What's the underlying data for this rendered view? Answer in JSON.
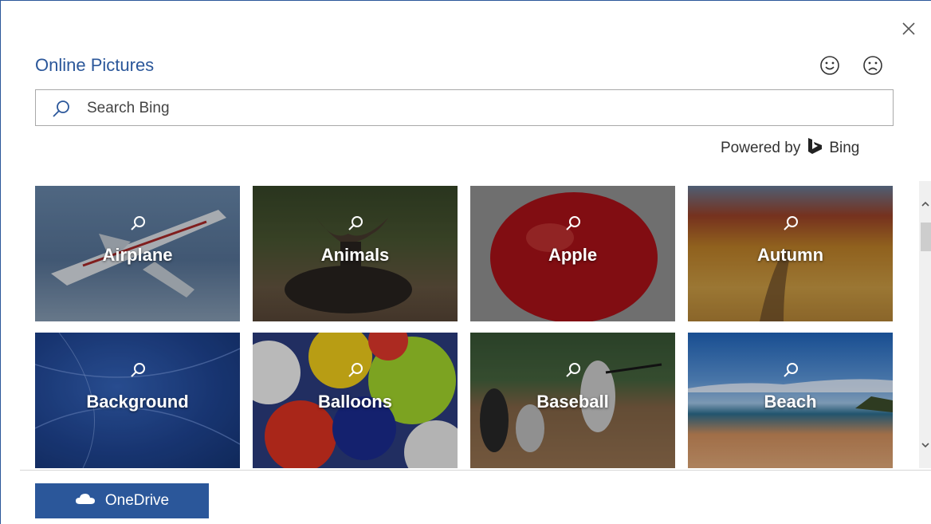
{
  "dialog": {
    "title": "Online Pictures",
    "close_icon": "close-icon",
    "feedback": {
      "happy_icon": "smile-icon",
      "sad_icon": "frown-icon"
    }
  },
  "search": {
    "placeholder": "Search Bing",
    "value": "",
    "icon": "search-icon"
  },
  "powered_by": {
    "prefix": "Powered by",
    "brand": "Bing",
    "brand_icon": "bing-logo-icon"
  },
  "categories": [
    {
      "label": "Airplane"
    },
    {
      "label": "Animals"
    },
    {
      "label": "Apple"
    },
    {
      "label": "Autumn"
    },
    {
      "label": "Background"
    },
    {
      "label": "Balloons"
    },
    {
      "label": "Baseball"
    },
    {
      "label": "Beach"
    }
  ],
  "footer": {
    "onedrive_label": "OneDrive",
    "onedrive_icon": "cloud-icon"
  },
  "colors": {
    "accent": "#2b579a",
    "button_text": "#ffffff"
  }
}
